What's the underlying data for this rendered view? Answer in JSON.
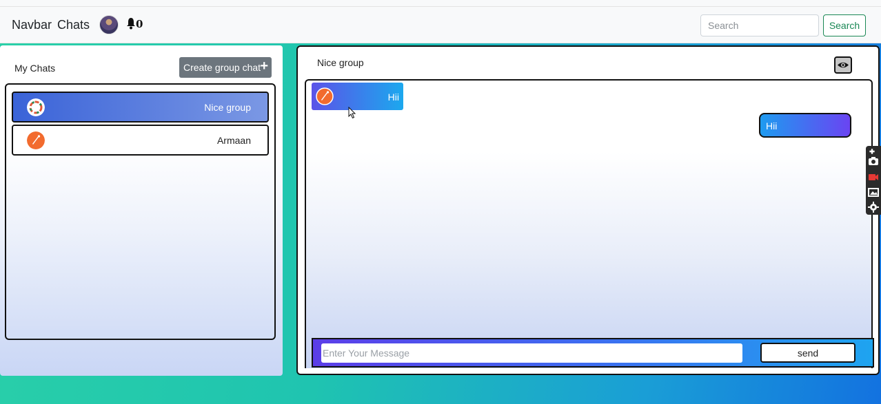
{
  "navbar": {
    "brand": "Navbar",
    "chats_link": "Chats",
    "notification_count": "0",
    "search_placeholder": "Search",
    "search_button": "Search"
  },
  "sidebar": {
    "title": "My Chats",
    "create_group_label": "Create group chat",
    "create_group_icon": "plus-icon",
    "chats": [
      {
        "name": "Nice group",
        "active": true
      },
      {
        "name": "Armaan",
        "active": false
      }
    ]
  },
  "chat": {
    "title": "Nice group",
    "messages": [
      {
        "text": "Hii",
        "side": "left"
      },
      {
        "text": "Hii",
        "side": "right"
      }
    ],
    "input_placeholder": "Enter Your Message",
    "send_label": "send"
  },
  "colors": {
    "active_chat": "#3a63d8",
    "message_left": "#1ca8ee",
    "message_right": "#6a44f2",
    "search_button": "#198754"
  }
}
